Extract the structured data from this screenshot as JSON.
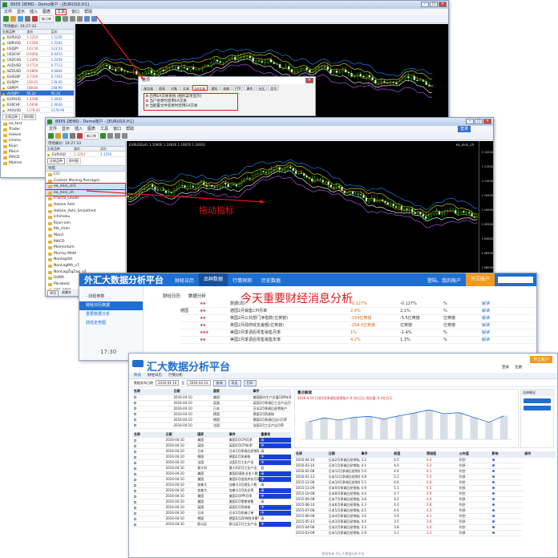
{
  "colors": {
    "accent": "#1f6fd0",
    "annotation": "#e01818",
    "orange": "#f39a1e"
  },
  "mt4_back": {
    "title": "8955 DEMO - Demo账户 - [EURUSD,H1]",
    "menu": [
      "文件",
      "显示",
      "插入",
      "图表",
      "工具",
      "窗口",
      "帮助"
    ],
    "highlighted_menu_index": 4,
    "toolbar_label": "新订单",
    "panel_title": "市场报价: 19:27:33",
    "columns": [
      "交易品种",
      "卖价",
      "买价"
    ],
    "quotes": [
      {
        "sym": "EURUSD",
        "bid": "1.1254",
        "ask": "1.1256"
      },
      {
        "sym": "GBPUSD",
        "bid": "1.5290",
        "ask": "1.5292"
      },
      {
        "sym": "USDJPY",
        "bid": "123.50",
        "ask": "123.53"
      },
      {
        "sym": "USDCHF",
        "bid": "0.9450",
        "ask": "0.9453"
      },
      {
        "sym": "USDCAD",
        "bid": "1.2456",
        "ask": "1.2459"
      },
      {
        "sym": "AUDUSD",
        "bid": "0.7710",
        "ask": "0.7713"
      },
      {
        "sym": "NZDUSD",
        "bid": "0.6860",
        "ask": "0.6864"
      },
      {
        "sym": "EURGBP",
        "bid": "0.7360",
        "ask": "0.7363"
      },
      {
        "sym": "EURJPY",
        "bid": "139.01",
        "ask": "139.05"
      },
      {
        "sym": "GBPJPY",
        "bid": "188.84",
        "ask": "188.90"
      },
      {
        "sym": "AUDJPY",
        "bid": "95.22",
        "ask": "95.26"
      },
      {
        "sym": "EURAUD",
        "bid": "1.4598",
        "ask": "1.4602"
      },
      {
        "sym": "EURCHF",
        "bid": "1.0636",
        "ask": "1.0640"
      },
      {
        "sym": "XAUUSD",
        "bid": "1178.40",
        "ask": "1178.90"
      }
    ],
    "tabs": [
      "交易品种",
      "即时图"
    ],
    "left_list": [
      "ea_test",
      "Trader",
      "Heiken",
      "Ichimo",
      "Kijun",
      "Macd",
      "MACD",
      "Momen"
    ]
  },
  "options_dialog": {
    "title": "选项",
    "tabs": [
      "服务器",
      "图表",
      "对象",
      "交易",
      "EA交易",
      "通知",
      "电邮",
      "FTP",
      "事件",
      "社区",
      "信号"
    ],
    "checks": [
      "启用EA交易系统 (图形菜单显示)",
      "当户变更时禁用EA交易",
      "当配置文件变更时禁用EA交易"
    ]
  },
  "mt4_front": {
    "title": "8955 DEMO - Demo账户 - [EURUSD,H1]",
    "menu": [
      "文件",
      "显示",
      "插入",
      "图表",
      "工具",
      "窗口",
      "帮助"
    ],
    "login_button": "登录",
    "chart_header": "EURUSD,H1 1.10900 1.10930 1.10870 1.10910",
    "indicator_tag": "ea_mini_ch",
    "panel_title": "市场报价: 19:27:33",
    "columns": [
      "交易品种",
      "卖价",
      "买价"
    ],
    "quote": {
      "sym": "EURUSD",
      "bid": "1.1254",
      "ask": "1.1256"
    },
    "tabs": [
      "交易品种",
      "即时图"
    ],
    "navigator_title": "导航",
    "indicators": [
      "CCI",
      "Custom Moving Averages",
      "ea_mini_ch1",
      "ea_mini_ch",
      "Fractal_Levels",
      "Heiken Ashi",
      "Heiken_Ashi_Smoothed",
      "Ichimoku",
      "Kijun-sen",
      "Ma_chan",
      "Macd",
      "MACD",
      "Momentum",
      "Murrey Math",
      "Nonlagdot",
      "NonLagMA_v7",
      "NonLagZigZag_v2",
      "OsMA",
      "Parabolic",
      "pan_ngos",
      "Price Channel"
    ],
    "selected_indicator_indices": [
      2,
      3
    ],
    "bottom_tabs": [
      "常用",
      "收藏夹"
    ],
    "price_labels": [
      "1.12000",
      "1.11500",
      "1.11000",
      "1.10500",
      "1.10000",
      "1.09500",
      "1.09000",
      "1.08500",
      "1.08000",
      "1.07500"
    ]
  },
  "annotations": {
    "drag": "拖动指标",
    "news": "今天重要财经消息分析"
  },
  "web_mid": {
    "brand": "外汇大数据分析平台",
    "nav": [
      "财经日历",
      "品种数据",
      "行情预测",
      "历史数据"
    ],
    "right_nav": [
      "登陆、我的账户",
      "开立账户"
    ],
    "sidebar": [
      "- 财经参数",
      "财经日历数据",
      "重要数据分析",
      "财经走势图"
    ],
    "tabs": [
      "财经日历",
      "数据分析"
    ],
    "time": "17:30",
    "rows": [
      {
        "cty": "",
        "stars": "★★",
        "name": "数据(周)",
        "v1": "-0.127%",
        "v2": "-0.127%",
        "v3": "%",
        "link": "解读"
      },
      {
        "cty": "德国",
        "stars": "★★",
        "name": "德国2月销售CPI月率",
        "v1": "2.4%",
        "v2": "2.1%",
        "v3": "%",
        "link": "解读"
      },
      {
        "cty": "",
        "stars": "★★",
        "name": "英国2月公共部门净借款(亿英镑)",
        "v1": "-154亿英镑",
        "v2": "-5.5亿英镑",
        "v3": "亿英镑",
        "link": "解读"
      },
      {
        "cty": "",
        "stars": "★★",
        "name": "英国2月政府收支差额(亿英镑)",
        "v1": "-254.3亿英镑",
        "v2": "亿英镑",
        "v3": "亿英镑",
        "link": "解读"
      },
      {
        "cty": "",
        "stars": "★★★",
        "name": "美国2月季调后零售销售月率",
        "v1": "1%",
        "v2": "-2.4%",
        "v3": "%",
        "link": "解读"
      },
      {
        "cty": "",
        "stars": "★★",
        "name": "美国2月季调后零售销售年率",
        "v1": "4.2%",
        "v2": "1.3%",
        "v3": "%",
        "link": "解读"
      }
    ]
  },
  "web_front": {
    "brand": "汇大数据分析平台",
    "top_links": [
      "开立账户",
      "登录",
      "注册"
    ],
    "tabs": [
      "数据",
      "财经日历",
      "行情分析"
    ],
    "filter": {
      "from_label": "数据发布日期",
      "date_from": "2016-04-10",
      "to_label": "至",
      "date_to": "2016-04-10",
      "search": "查询",
      "export": "导出",
      "print": "打印"
    },
    "chart_title": "重点解读",
    "chart_note": "2016-4-10 日本2月季调后经常账户 6.3亿日元 实际值: 6.3亿日元",
    "left_header": [
      "名称",
      "日期",
      "国家",
      "事件"
    ],
    "left_rows": [
      [
        "2016-04-10",
        "美国",
        "美国国内生产总值GDP年率数据"
      ],
      [
        "2016-04-10",
        "英国",
        "英国2月季调后工业产出月率"
      ],
      [
        "2016-04-10",
        "日本",
        "日本2月季调后经常账户"
      ],
      [
        "2016-04-10",
        "德国",
        "德国2月贸易帐"
      ],
      [
        "2016-04-10",
        "德国",
        "德国2月季调后出口月率"
      ],
      [
        "2016-04-10",
        "法国",
        "法国2月工业产出月率"
      ]
    ],
    "table2_header": [
      "名称",
      "日期",
      "国家",
      "事件",
      "重要性"
    ],
    "table2_rows": [
      [
        "2016-04-10",
        "美国",
        "美国3月CPI月率",
        "高"
      ],
      [
        "2016-04-10",
        "英国",
        "英国3月CPI年率",
        "中"
      ],
      [
        "2016-04-10",
        "日本",
        "日本2月季调后经常账户",
        "高"
      ],
      [
        "2016-04-10",
        "德国",
        "德国2月贸易帐",
        "中"
      ],
      [
        "2016-04-10",
        "法国",
        "法国2月工业产出",
        "中"
      ],
      [
        "2016-04-10",
        "意大利",
        "意大利2月工业产出",
        "低"
      ],
      [
        "2016-04-10",
        "美国",
        "美国初请失业金人数",
        "高"
      ],
      [
        "2016-04-10",
        "美国",
        "美国2月批发库存月率",
        "中"
      ],
      [
        "2016-04-10",
        "加拿大",
        "加拿大3月就业人数",
        "高"
      ],
      [
        "2016-04-10",
        "加拿大",
        "加拿大3月失业率",
        "高"
      ],
      [
        "2016-04-10",
        "美国",
        "美国3月PPI月率",
        "中"
      ],
      [
        "2016-04-10",
        "美国",
        "美国3月零售销售",
        "高"
      ],
      [
        "2016-04-10",
        "英国",
        "英国2月贸易帐",
        "中"
      ],
      [
        "2016-04-10",
        "日本",
        "日本2月机械订单",
        "中"
      ],
      [
        "2016-04-10",
        "德国",
        "德国3月ZEW经济景气指数",
        "高"
      ],
      [
        "2016-04-10",
        "欧元区",
        "欧元区2月工业产出",
        "中"
      ]
    ],
    "table3_header": [
      "名称",
      "日期",
      "事件",
      "前值",
      "预测值",
      "公布值",
      "影响",
      "操作"
    ],
    "table3_rows": [
      [
        "2016-04-10",
        "日本2月季调后经常账户",
        "3.2",
        "4.5",
        "4.4",
        "利空"
      ],
      [
        "2016-03-10",
        "日本1月季调后经常账户",
        "4.1",
        "4.0",
        "3.2",
        "利多"
      ],
      [
        "2016-02-08",
        "日本12月季调后经常账户",
        "5.0",
        "4.4",
        "4.1",
        "利空"
      ],
      [
        "2016-01-13",
        "日本11月季调后经常账户",
        "4.8",
        "5.2",
        "5.0",
        "利多"
      ],
      [
        "2015-12-08",
        "日本10月季调后经常账户",
        "5.5",
        "4.6",
        "4.8",
        "利空"
      ],
      [
        "2015-11-09",
        "日本9月季调后经常账户",
        "4.9",
        "5.1",
        "5.5",
        "利多"
      ],
      [
        "2015-10-08",
        "日本8月季调后经常账户",
        "4.4",
        "4.7",
        "4.9",
        "利空"
      ],
      [
        "2015-09-08",
        "日本7月季调后经常账户",
        "3.8",
        "4.2",
        "4.4",
        "利多"
      ],
      [
        "2015-08-10",
        "日本6月季调后经常账户",
        "4.3",
        "4.0",
        "3.8",
        "利空"
      ],
      [
        "2015-07-08",
        "日本5月季调后经常账户",
        "4.1",
        "4.6",
        "4.3",
        "利多"
      ],
      [
        "2015-06-08",
        "日本4月季调后经常账户",
        "3.6",
        "3.9",
        "4.1",
        "利空"
      ],
      [
        "2015-05-13",
        "日本3月季调后经常账户",
        "4.0",
        "3.5",
        "3.6",
        "利多"
      ],
      [
        "2015-04-08",
        "日本2月季调后经常账户",
        "3.3",
        "3.8",
        "4.0",
        "利空"
      ],
      [
        "2015-03-09",
        "日本1月季调后经常账户",
        "2.9",
        "3.1",
        "3.3",
        "利多"
      ]
    ],
    "right_panel_title": "总体概况",
    "footer": "版权所有 外汇大数据分析平台"
  }
}
